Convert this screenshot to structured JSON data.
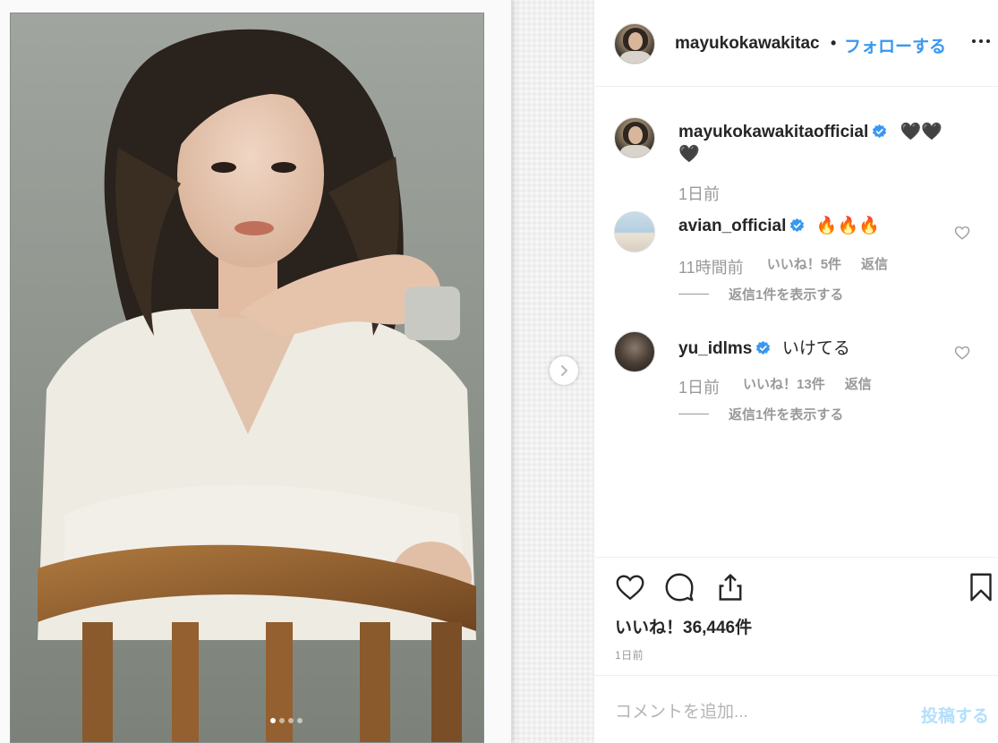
{
  "post": {
    "author": "mayukokawakitaofficial",
    "author_truncated": "mayukokawakitac",
    "header_separator": "•",
    "follow_label": "フォローする",
    "caption_emojis_line1": "🖤🖤",
    "caption_emojis_line2": "🖤",
    "caption_time": "1日前",
    "likes_label": "いいね！36,446件",
    "time_label": "1日前"
  },
  "comments": [
    {
      "username": "avian_official",
      "text": "🔥🔥🔥",
      "time": "11時間前",
      "likes": "いいね！5件",
      "reply_label": "返信",
      "view_replies": "返信1件を表示する"
    },
    {
      "username": "yu_idlms",
      "text": "いけてる",
      "time": "1日前",
      "likes": "いいね！13件",
      "reply_label": "返信",
      "view_replies": "返信1件を表示する"
    }
  ],
  "comment_box": {
    "placeholder": "コメントを追加...",
    "post_label": "投稿する"
  },
  "carousel": {
    "count": 4,
    "active": 0
  },
  "colors": {
    "link_blue": "#3897f0",
    "post_button_disabled": "#b2dffc",
    "verified_blue": "#3897f0"
  },
  "icons": [
    "heart-icon",
    "comment-icon",
    "share-icon",
    "bookmark-icon",
    "chevron-right-icon",
    "verified-badge-icon",
    "more-options-icon"
  ]
}
